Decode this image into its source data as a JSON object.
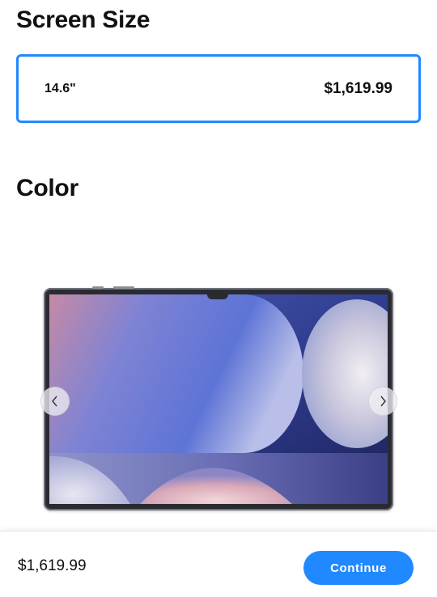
{
  "screen_size": {
    "heading": "Screen Size",
    "selected_option": {
      "label": "14.6\"",
      "price": "$1,619.99"
    }
  },
  "color": {
    "heading": "Color"
  },
  "footer": {
    "price": "$1,619.99",
    "continue_label": "Continue"
  },
  "colors": {
    "accent": "#2189ff"
  },
  "icons": {
    "prev": "chevron-left-icon",
    "next": "chevron-right-icon"
  }
}
